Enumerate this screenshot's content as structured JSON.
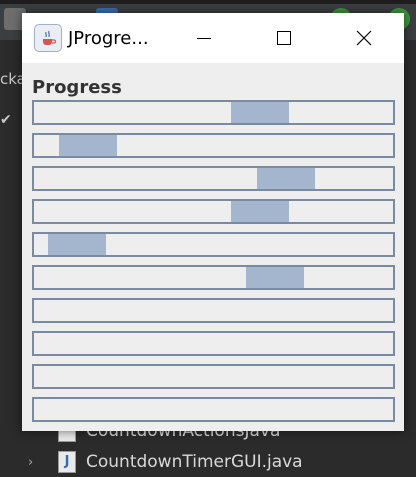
{
  "window": {
    "title": "JProgre...",
    "heading": "Progress"
  },
  "progress_bars": [
    {
      "indeterminate": true,
      "highlight_position": 0.55
    },
    {
      "indeterminate": true,
      "highlight_position": 0.07
    },
    {
      "indeterminate": true,
      "highlight_position": 0.62
    },
    {
      "indeterminate": true,
      "highlight_position": 0.55
    },
    {
      "indeterminate": true,
      "highlight_position": 0.04
    },
    {
      "indeterminate": true,
      "highlight_position": 0.59
    },
    {
      "indeterminate": false,
      "value": 0
    },
    {
      "indeterminate": false,
      "value": 0
    },
    {
      "indeterminate": false,
      "value": 0
    },
    {
      "indeterminate": false,
      "value": 0
    }
  ],
  "background": {
    "side_text": "cka",
    "file_row_partial": "CountdownActionsJava",
    "file_row": "CountdownTimerGUI.java"
  },
  "colors": {
    "bar_border": "#7a8aa1",
    "bar_fill": "#a4b6cd",
    "dialog_bg": "#eeeeee"
  }
}
